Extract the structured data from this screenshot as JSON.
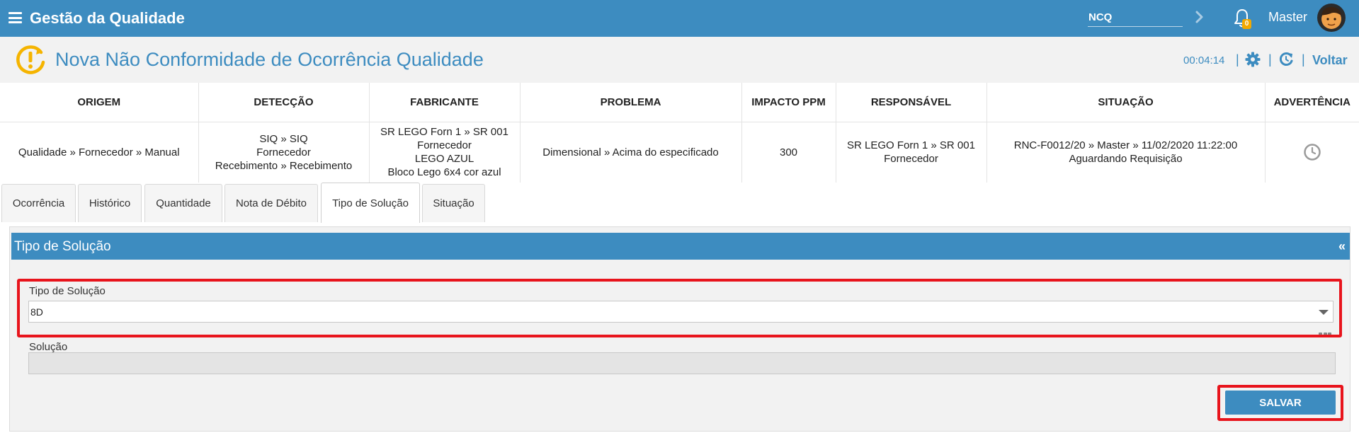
{
  "app": {
    "title": "Gestão da Qualidade",
    "search_value": "NCQ",
    "notification_count": "0",
    "user_name": "Master"
  },
  "page": {
    "title": "Nova Não Conformidade de Ocorrência Qualidade",
    "timer": "00:04:14",
    "back_label": "Voltar"
  },
  "summary": {
    "headers": [
      "ORIGEM",
      "DETECÇÃO",
      "FABRICANTE",
      "PROBLEMA",
      "IMPACTO PPM",
      "RESPONSÁVEL",
      "SITUAÇÃO",
      "ADVERTÊNCIA"
    ],
    "origem": [
      "Qualidade » Fornecedor » Manual"
    ],
    "deteccao": [
      "SIQ » SIQ",
      "Fornecedor",
      "Recebimento » Recebimento"
    ],
    "fabricante": [
      "SR LEGO Forn 1 » SR 001",
      "Fornecedor",
      "LEGO AZUL",
      "Bloco Lego 6x4 cor azul"
    ],
    "problema": [
      "Dimensional » Acima do especificado"
    ],
    "impacto": [
      "300"
    ],
    "responsavel": [
      "SR LEGO Forn 1 » SR 001",
      "Fornecedor"
    ],
    "situacao": [
      "RNC-F0012/20 » Master » 11/02/2020 11:22:00",
      "Aguardando Requisição"
    ]
  },
  "tabs": [
    {
      "label": "Ocorrência"
    },
    {
      "label": "Histórico"
    },
    {
      "label": "Quantidade"
    },
    {
      "label": "Nota de Débito"
    },
    {
      "label": "Tipo de Solução",
      "active": true
    },
    {
      "label": "Situação"
    }
  ],
  "panel": {
    "title": "Tipo de Solução",
    "collapse_label": "«",
    "solution_type_label": "Tipo de Solução",
    "solution_type_value": "8D",
    "solution_label": "Solução",
    "solution_value": "",
    "save_label": "SALVAR"
  },
  "colors": {
    "primary": "#3d8cc0",
    "highlight": "#e8141c",
    "badge": "#f2a900",
    "icon_orange": "#f5b400"
  }
}
